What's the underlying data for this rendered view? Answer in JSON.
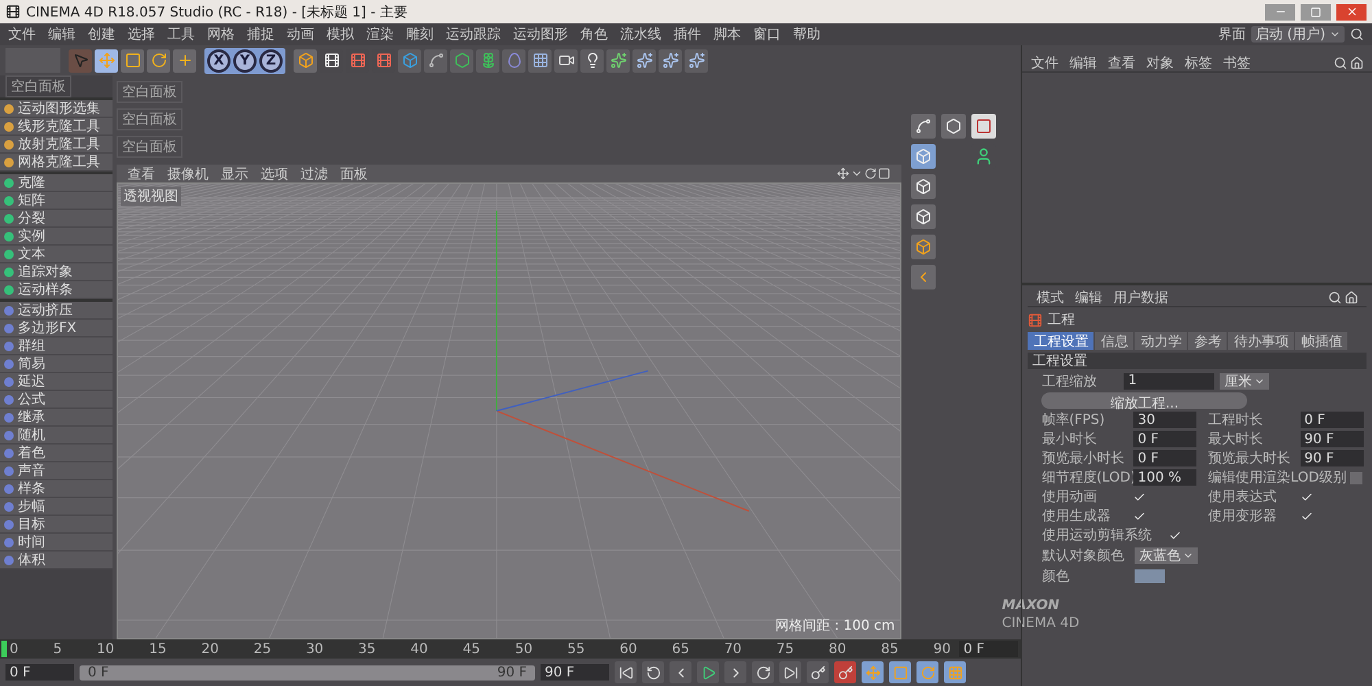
{
  "window": {
    "title": "CINEMA 4D R18.057 Studio (RC - R18) - [未标题 1] - 主要"
  },
  "menu": [
    "文件",
    "编辑",
    "创建",
    "选择",
    "工具",
    "网格",
    "捕捉",
    "动画",
    "模拟",
    "渲染",
    "雕刻",
    "运动跟踪",
    "运动图形",
    "角色",
    "流水线",
    "插件",
    "脚本",
    "窗口",
    "帮助"
  ],
  "layout": {
    "label": "界面",
    "value": "启动 (用户)"
  },
  "toolbar": {
    "axes": [
      "X",
      "Y",
      "Z"
    ]
  },
  "palette": {
    "header": "空白面板",
    "groups": [
      [
        "运动图形选集",
        "线形克隆工具",
        "放射克隆工具",
        "网格克隆工具"
      ],
      [
        "克隆",
        "矩阵",
        "分裂",
        "实例",
        "文本",
        "追踪对象",
        "运动样条"
      ],
      [
        "运动挤压",
        "多边形FX",
        "群组",
        "简易",
        "延迟",
        "公式",
        "继承",
        "随机",
        "着色",
        "声音",
        "样条",
        "步幅",
        "目标",
        "时间",
        "体积"
      ]
    ]
  },
  "panels": [
    "空白面板",
    "空白面板",
    "空白面板"
  ],
  "viewport": {
    "menu": [
      "查看",
      "摄像机",
      "显示",
      "选项",
      "过滤",
      "面板"
    ],
    "label": "透视视图",
    "grid_info": "网格间距 : 100 cm",
    "logo": [
      "MAXON",
      "CINEMA 4D"
    ]
  },
  "object_manager": {
    "menu": [
      "文件",
      "编辑",
      "查看",
      "对象",
      "标签",
      "书签"
    ]
  },
  "attributes": {
    "menu": [
      "模式",
      "编辑",
      "用户数据"
    ],
    "object": "工程",
    "tabs": [
      {
        "label": "工程设置",
        "selected": true
      },
      {
        "label": "信息",
        "selected": false
      },
      {
        "label": "动力学",
        "selected": false
      },
      {
        "label": "参考",
        "selected": false
      },
      {
        "label": "待办事项",
        "selected": false
      },
      {
        "label": "帧插值",
        "selected": false
      }
    ],
    "section": "工程设置",
    "scale": {
      "label": "工程缩放",
      "value": "1",
      "unit": "厘米"
    },
    "button": "缩放工程...",
    "fields": [
      {
        "label": "帧率(FPS)",
        "value": "30"
      },
      {
        "label": "工程时长",
        "value": "0 F"
      },
      {
        "label": "最小时长",
        "value": "0 F"
      },
      {
        "label": "最大时长",
        "value": "90 F"
      },
      {
        "label": "预览最小时长",
        "value": "0 F"
      },
      {
        "label": "预览最大时长",
        "value": "90 F"
      }
    ],
    "lod": {
      "label": "细节程度(LOD)",
      "value": "100 %"
    },
    "lod_check": {
      "label": "编辑使用渲染LOD级别",
      "checked": false
    },
    "checks": [
      {
        "label": "使用动画",
        "checked": true
      },
      {
        "label": "使用表达式",
        "checked": true
      },
      {
        "label": "使用生成器",
        "checked": true
      },
      {
        "label": "使用变形器",
        "checked": true
      },
      {
        "label": "使用运动剪辑系统",
        "checked": true
      }
    ],
    "default_color": {
      "label": "默认对象颜色",
      "value": "灰蓝色"
    },
    "color": {
      "label": "颜色"
    }
  },
  "timeline": {
    "ticks": [
      "0",
      "5",
      "10",
      "15",
      "20",
      "25",
      "30",
      "35",
      "40",
      "45",
      "50",
      "55",
      "60",
      "65",
      "70",
      "75",
      "80",
      "85",
      "90"
    ],
    "frame": "0 F"
  },
  "transport": {
    "start": "0 F",
    "range_start": "0 F",
    "range_end": "90 F",
    "end": "90 F"
  }
}
